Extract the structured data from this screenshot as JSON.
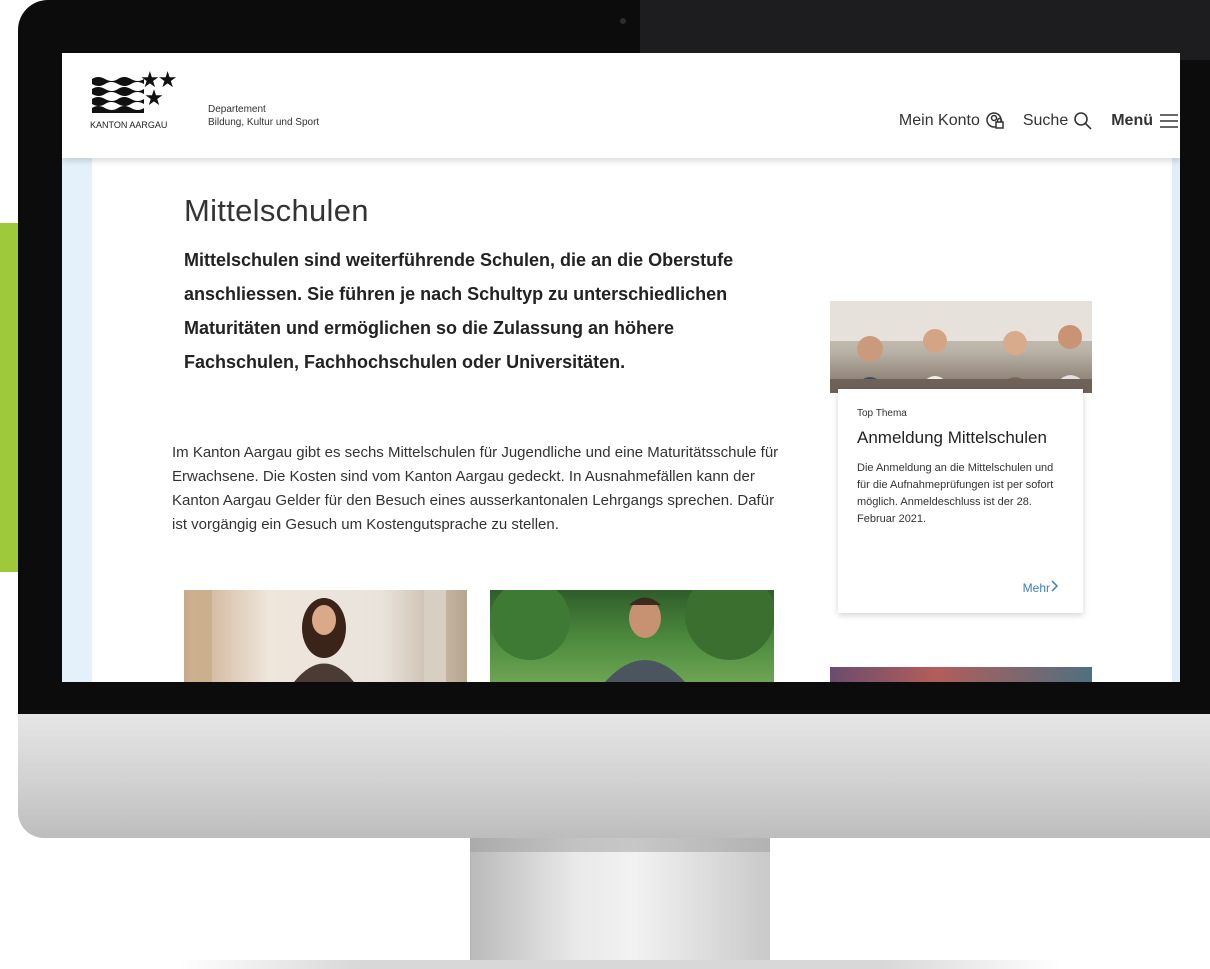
{
  "header": {
    "logo_text": "KANTON AARGAU",
    "department_label": "Departement",
    "department_name": "Bildung, Kultur und Sport",
    "nav": {
      "account": "Mein Konto",
      "search": "Suche",
      "menu": "Menü"
    }
  },
  "main": {
    "title": "Mittelschulen",
    "lead": "Mittelschulen sind weiterführende Schulen, die an die Oberstufe anschliessen. Sie führen je nach Schultyp zu unterschiedlichen Maturitäten und ermöglichen so die Zulassung an höhere Fachschulen, Fachhochschulen oder Universitäten.",
    "body": "Im Kanton Aargau gibt es sechs Mittelschulen für Jugendliche und eine Maturitätsschule für Erwachsene. Die Kosten sind vom Kanton Aargau gedeckt. In Ausnahmefällen kann der Kanton Aargau Gelder für den Besuch eines ausserkantonalen Lehrgangs sprechen. Dafür ist vorgängig ein Gesuch um Kostengutsprache zu stellen."
  },
  "teaser": {
    "kicker": "Top Thema",
    "title": "Anmeldung Mittelschulen",
    "text": "Die Anmeldung an die Mittelschulen und für die Aufnahmeprüfungen ist per sofort möglich. Anmeldeschluss ist der 28. Februar 2021.",
    "more": "Mehr"
  },
  "icons": {
    "account": "account-lock-icon",
    "search": "search-icon",
    "menu": "hamburger-icon",
    "more": "chevron-right-icon"
  },
  "colors": {
    "accent_green": "#9ec93b",
    "link_blue": "#3a7fc1",
    "side_band": "#e4f1fa"
  }
}
